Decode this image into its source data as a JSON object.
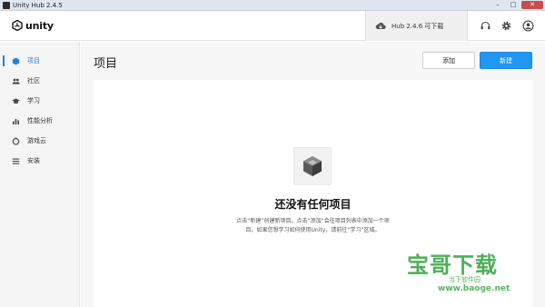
{
  "window": {
    "title": "Unity Hub 2.4.5",
    "controls": {
      "minimize": "–",
      "maximize": "□",
      "close": "✕"
    }
  },
  "header": {
    "logo_text": "unity",
    "update_text": "Hub 2.4.6 可下载",
    "icons": [
      "cloud-download-icon",
      "headset-icon",
      "gear-icon",
      "account-icon"
    ]
  },
  "sidebar": {
    "items": [
      {
        "label": "项目",
        "icon": "projects-icon",
        "active": true
      },
      {
        "label": "社区",
        "icon": "community-icon",
        "active": false
      },
      {
        "label": "学习",
        "icon": "learn-icon",
        "active": false
      },
      {
        "label": "性能分析",
        "icon": "analytics-icon",
        "active": false
      },
      {
        "label": "游戏云",
        "icon": "cloud-icon",
        "active": false
      },
      {
        "label": "安装",
        "icon": "installs-icon",
        "active": false
      }
    ]
  },
  "main": {
    "title": "项目",
    "add_label": "添加",
    "new_label": "新建",
    "empty_title": "还没有任何项目",
    "empty_desc_line1": "点击“新建”创建新项目。点击“添加”会往项目列表中添加一个项",
    "empty_desc_line2": "目。如果您想学习如何使用Unity，请前往“学习”区域。"
  },
  "watermark": {
    "big": "宝哥下载",
    "small": "当下软件园",
    "url": "www.baoge.net"
  },
  "colors": {
    "accent": "#2196f3",
    "sidebar_bg": "#f5f5f5",
    "main_bg": "#f7f7f7",
    "watermark": "#3aa845"
  }
}
